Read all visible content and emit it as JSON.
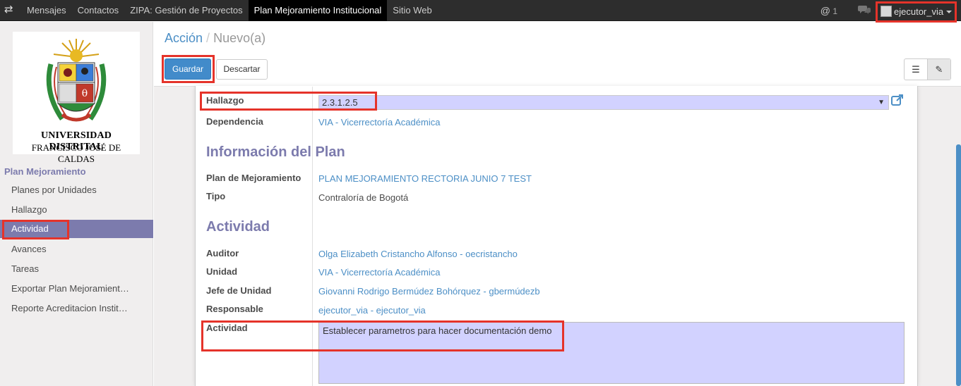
{
  "topbar": {
    "menu": [
      "Mensajes",
      "Contactos",
      "ZIPA: Gestión de Proyectos",
      "Plan Mejoramiento Institucional",
      "Sitio Web"
    ],
    "active_index": 3,
    "notification_count": "1",
    "user": "ejecutor_via"
  },
  "logo": {
    "line1": "UNIVERSIDAD DISTRITAL",
    "line2": "FRANCISCO JOSÉ DE CALDAS"
  },
  "sidebar": {
    "title": "Plan Mejoramiento",
    "items": [
      "Planes por Unidades",
      "Hallazgo",
      "Actividad",
      "Avances",
      "Tareas",
      "Exportar Plan Mejoramient…",
      "Reporte Acreditacion Instit…"
    ],
    "active_index": 2
  },
  "breadcrumb": {
    "parent": "Acción",
    "separator": "/",
    "current": "Nuevo(a)"
  },
  "buttons": {
    "save": "Guardar",
    "discard": "Descartar"
  },
  "form": {
    "hallazgo_label": "Hallazgo",
    "hallazgo_value": "2.3.1.2.5",
    "dependencia_label": "Dependencia",
    "dependencia_value": "VIA - Vicerrectoría Académica",
    "section_plan": "Información del Plan",
    "plan_label": "Plan de Mejoramiento",
    "plan_value": "PLAN MEJORAMIENTO RECTORIA JUNIO 7 TEST",
    "tipo_label": "Tipo",
    "tipo_value": "Contraloría de Bogotá",
    "section_actividad": "Actividad",
    "auditor_label": "Auditor",
    "auditor_value": "Olga Elizabeth Cristancho Alfonso - oecristancho",
    "unidad_label": "Unidad",
    "unidad_value": "VIA - Vicerrectoría Académica",
    "jefe_label": "Jefe de Unidad",
    "jefe_value": "Giovanni Rodrigo Bermúdez Bohórquez - gbermúdezb",
    "responsable_label": "Responsable",
    "responsable_value": "ejecutor_via - ejecutor_via",
    "actividad_label": "Actividad",
    "actividad_value": "Establecer parametros para hacer documentación demo"
  },
  "colors": {
    "accent": "#7c7bad",
    "link": "#4c8fc6",
    "primary": "#428bca",
    "highlight": "#e5332a",
    "field_bg": "#d2d2ff"
  }
}
